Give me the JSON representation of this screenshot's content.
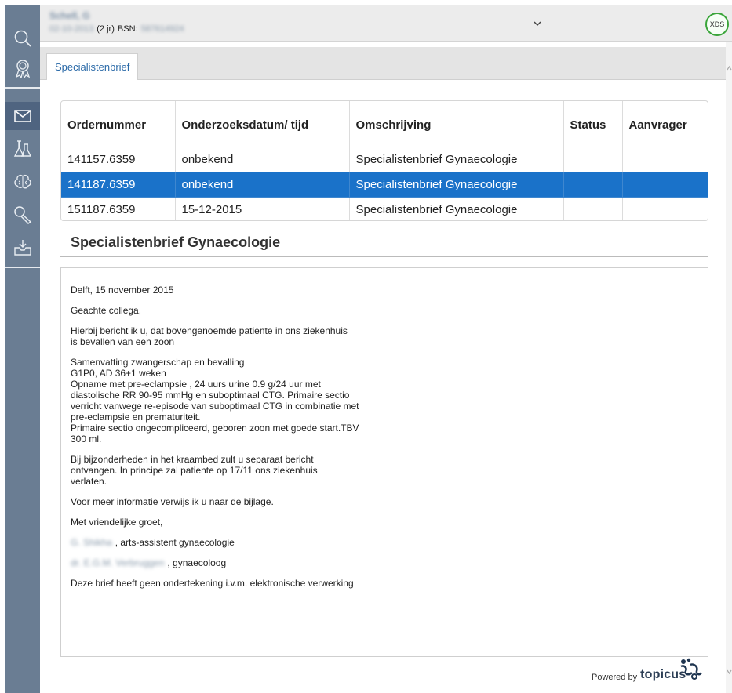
{
  "patient": {
    "name": "Schell, G",
    "dob": "02-10-2013",
    "age": "(2 jr)",
    "bsn_label": "BSN:",
    "bsn": "587614924"
  },
  "header": {
    "xds_label": "XDS"
  },
  "tabs": [
    {
      "label": "Specialistenbrief",
      "active": true
    }
  ],
  "orders": {
    "columns": [
      "Ordernummer",
      "Onderzoeksdatum/ tijd",
      "Omschrijving",
      "Status",
      "Aanvrager"
    ],
    "rows": [
      {
        "ordernummer": "141157.6359",
        "datum": "onbekend",
        "omschrijving": "Specialistenbrief Gynaecologie",
        "status": "",
        "aanvrager": "",
        "selected": false
      },
      {
        "ordernummer": "141187.6359",
        "datum": "onbekend",
        "omschrijving": "Specialistenbrief Gynaecologie",
        "status": "",
        "aanvrager": "",
        "selected": true
      },
      {
        "ordernummer": "151187.6359",
        "datum": "15-12-2015",
        "omschrijving": "Specialistenbrief Gynaecologie",
        "status": "",
        "aanvrager": "",
        "selected": false
      }
    ]
  },
  "letter": {
    "title": "Specialistenbrief Gynaecologie",
    "paragraphs": [
      "Delft, 15 november 2015",
      "Geachte collega,",
      "Hierbij bericht ik u, dat bovengenoemde patiente in ons ziekenhuis\nis bevallen van een  zoon",
      "Samenvatting zwangerschap en bevalling\nG1P0, AD 36+1 weken\nOpname met pre-eclampsie , 24 uurs urine 0.9 g/24 uur met\ndiastolische RR 90-95 mmHg en suboptimaal CTG. Primaire sectio\nverricht vanwege re-episode van suboptimaal CTG in combinatie met\npre-eclampsie en prematuriteit.\nPrimaire sectio ongecompliceerd, geboren zoon met goede start.TBV\n300 ml.",
      "Bij bijzonderheden in het kraambed zult u separaat bericht\nontvangen. In principe zal patiente op 17/11 ons ziekenhuis\nverlaten.",
      "Voor meer informatie verwijs ik u naar de bijlage.",
      "Met vriendelijke groet,"
    ],
    "signature_1": {
      "name": "G. Shikha",
      "role": ", arts-assistent gynaecologie"
    },
    "signature_2": {
      "name": "dr. E.G.M. Verbruggen",
      "role": ", gynaecoloog"
    },
    "closing": "Deze brief heeft geen ondertekening i.v.m. elektronische verwerking"
  },
  "footer": {
    "powered_by": "Powered by",
    "brand": "topicus"
  },
  "sidebar": {
    "icons": [
      "search-icon",
      "ribbon-icon",
      "mail-icon",
      "lab-flask-icon",
      "brain-icon",
      "search-doc-icon",
      "inbox-icon"
    ],
    "active": "mail-icon"
  },
  "colors": {
    "sidebar": "#6a7d93",
    "sidebar_active": "#4f6480",
    "selected_row": "#1a72c9",
    "xds_ring": "#3aa53a",
    "tab_text": "#2b6aa8"
  }
}
